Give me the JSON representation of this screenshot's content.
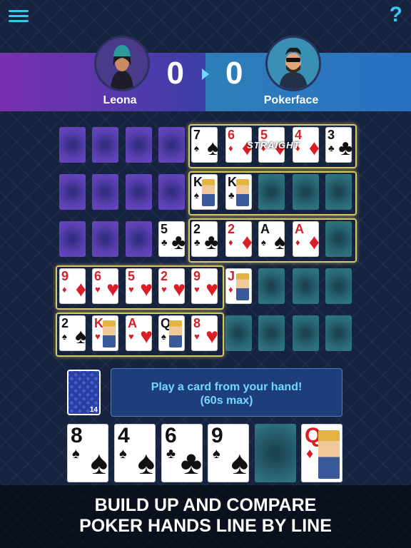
{
  "players": {
    "left": {
      "name": "Leona",
      "score": "0"
    },
    "right": {
      "name": "Pokerface",
      "score": "0"
    }
  },
  "board": {
    "straight_label": "STRAIGHT",
    "row1_cards": [
      {
        "rank": "7",
        "suit": "♠",
        "color": "black"
      },
      {
        "rank": "6",
        "suit": "♦",
        "color": "red"
      },
      {
        "rank": "5",
        "suit": "♦",
        "color": "red"
      },
      {
        "rank": "4",
        "suit": "♦",
        "color": "red"
      },
      {
        "rank": "3",
        "suit": "♣",
        "color": "black"
      }
    ],
    "row2_cards": [
      {
        "rank": "K",
        "suit": "♠",
        "color": "black"
      },
      {
        "rank": "K",
        "suit": "♣",
        "color": "black"
      }
    ],
    "row3_cards": [
      {
        "rank": "5",
        "suit": "♣",
        "color": "black"
      },
      {
        "rank": "2",
        "suit": "♣",
        "color": "black"
      },
      {
        "rank": "2",
        "suit": "♦",
        "color": "red"
      },
      {
        "rank": "A",
        "suit": "♠",
        "color": "black"
      },
      {
        "rank": "A",
        "suit": "♦",
        "color": "red"
      }
    ],
    "row4_cards": [
      {
        "rank": "9",
        "suit": "♦",
        "color": "red"
      },
      {
        "rank": "6",
        "suit": "♥",
        "color": "red"
      },
      {
        "rank": "5",
        "suit": "♥",
        "color": "red"
      },
      {
        "rank": "2",
        "suit": "♥",
        "color": "red"
      },
      {
        "rank": "9",
        "suit": "♥",
        "color": "red"
      },
      {
        "rank": "J",
        "suit": "♦",
        "color": "red"
      }
    ],
    "row5_cards": [
      {
        "rank": "2",
        "suit": "♠",
        "color": "black"
      },
      {
        "rank": "K",
        "suit": "♥",
        "color": "red"
      },
      {
        "rank": "A",
        "suit": "♥",
        "color": "red"
      },
      {
        "rank": "Q",
        "suit": "♠",
        "color": "black"
      },
      {
        "rank": "8",
        "suit": "♥",
        "color": "red"
      }
    ]
  },
  "deck": {
    "count": "14"
  },
  "message": {
    "line1": "Play a card from your hand!",
    "line2": "(60s max)"
  },
  "hand": [
    {
      "rank": "8",
      "suit": "♠",
      "color": "black"
    },
    {
      "rank": "4",
      "suit": "♠",
      "color": "black"
    },
    {
      "rank": "6",
      "suit": "♣",
      "color": "black"
    },
    {
      "rank": "9",
      "suit": "♠",
      "color": "black"
    },
    {
      "rank": "Q",
      "suit": "♦",
      "color": "red"
    }
  ],
  "banner": {
    "line1": "BUILD UP AND COMPARE",
    "line2": "POKER HANDS LINE BY LINE"
  }
}
